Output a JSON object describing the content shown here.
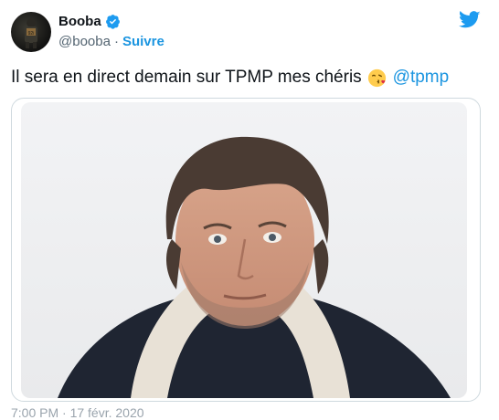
{
  "author": {
    "name": "Booba",
    "handle": "@booba",
    "separator": "·",
    "follow_label": "Suivre"
  },
  "tweet": {
    "text": "Il sera en direct demain sur TPMP mes chéris",
    "emoji": "kissing-face-with-heart-emoji",
    "mention": "@tpmp"
  },
  "media": {
    "kind": "photo"
  },
  "footer": {
    "timestamp_partial": "7:00 PM · 17 févr. 2020"
  },
  "colors": {
    "accent": "#1b95e0",
    "text": "#0f1419",
    "muted": "#536471",
    "border": "#cfd9de"
  }
}
